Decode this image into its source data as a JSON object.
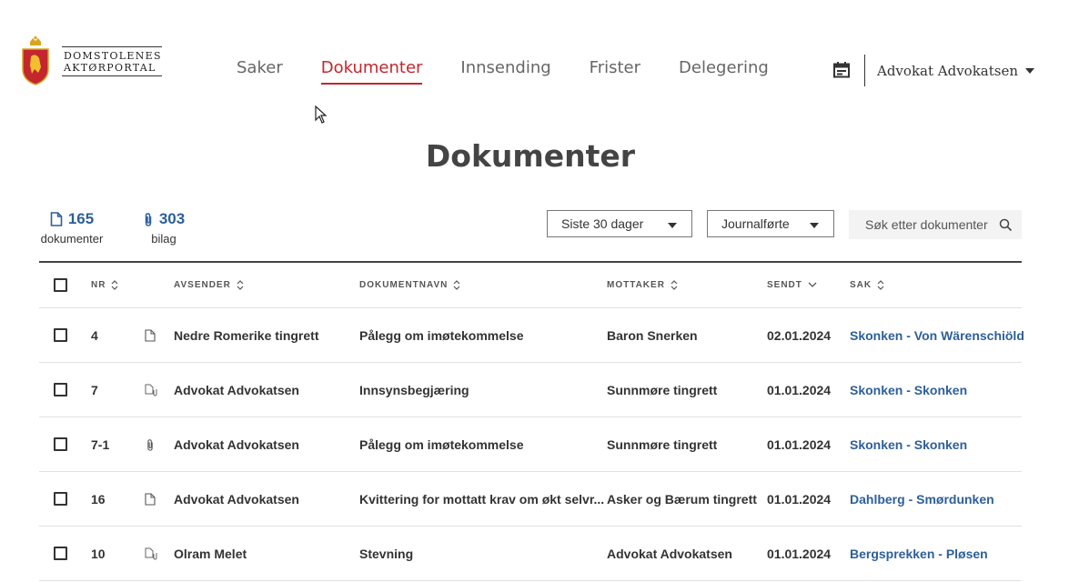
{
  "logo": {
    "line1": "DOMSTOLENES",
    "line2": "AKTØRPORTAL"
  },
  "nav": [
    {
      "label": "Saker"
    },
    {
      "label": "Dokumenter",
      "active": true
    },
    {
      "label": "Innsending"
    },
    {
      "label": "Frister"
    },
    {
      "label": "Delegering"
    }
  ],
  "user": {
    "name": "Advokat Advokatsen"
  },
  "page_title": "Dokumenter",
  "stats": {
    "documents": {
      "count": "165",
      "label": "dokumenter"
    },
    "attachments": {
      "count": "303",
      "label": "bilag"
    }
  },
  "filters": {
    "period": "Siste 30 dager",
    "status": "Journalførte",
    "search_placeholder": "Søk etter dokumenter"
  },
  "table": {
    "headers": {
      "nr": "NR",
      "sender": "AVSENDER",
      "docname": "DOKUMENTNAVN",
      "receiver": "MOTTAKER",
      "sent": "SENDT",
      "case": "SAK"
    },
    "rows": [
      {
        "nr": "4",
        "icon": "document-icon",
        "sender": "Nedre Romerike tingrett",
        "docname": "Pålegg om imøtekommelse",
        "receiver": "Baron Snerken",
        "sent": "02.01.2024",
        "case": "Skonken - Von Wärenschiöld"
      },
      {
        "nr": "7",
        "icon": "document-with-attachment-icon",
        "sender": "Advokat Advokatsen",
        "docname": "Innsynsbegjæring",
        "receiver": "Sunnmøre tingrett",
        "sent": "01.01.2024",
        "case": "Skonken - Skonken"
      },
      {
        "nr": "7-1",
        "icon": "attachment-icon",
        "sender": "Advokat Advokatsen",
        "docname": "Pålegg om imøtekommelse",
        "receiver": "Sunnmøre tingrett",
        "sent": "01.01.2024",
        "case": "Skonken - Skonken"
      },
      {
        "nr": "16",
        "icon": "document-icon",
        "sender": "Advokat Advokatsen",
        "docname": "Kvittering for mottatt krav om økt selvr...",
        "receiver": "Asker og Bærum tingrett",
        "sent": "01.01.2024",
        "case": "Dahlberg - Smørdunken"
      },
      {
        "nr": "10",
        "icon": "document-with-attachment-icon",
        "sender": "Olram Melet",
        "docname": "Stevning",
        "receiver": "Advokat Advokatsen",
        "sent": "01.01.2024",
        "case": "Bergsprekken - Pløsen"
      }
    ]
  },
  "colors": {
    "accent": "#c4262e",
    "link": "#2d5f9a"
  }
}
